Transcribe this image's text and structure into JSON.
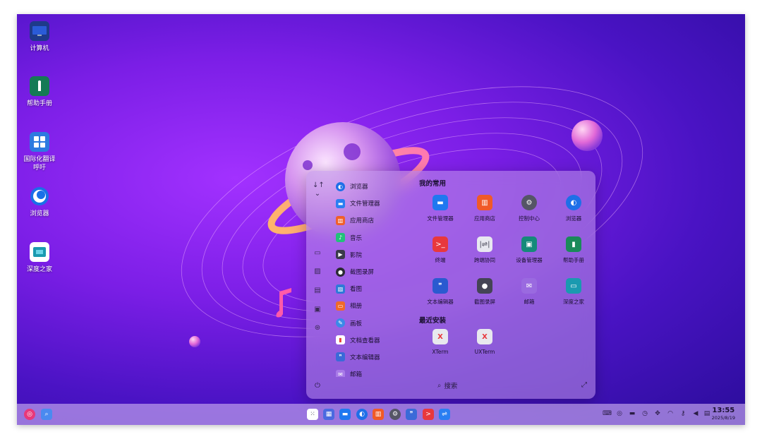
{
  "desktop": {
    "icons": [
      {
        "label": "计算机",
        "icon": "computer-icon"
      },
      {
        "label": "帮助手册",
        "icon": "help-manual-icon"
      },
      {
        "label": "国际化翻译",
        "label2": "呼吁",
        "icon": "translate-icon"
      },
      {
        "label": "浏览器",
        "icon": "browser-icon"
      },
      {
        "label": "深度之家",
        "icon": "deepin-home-icon"
      }
    ]
  },
  "launcher": {
    "applist": [
      {
        "label": "浏览器",
        "color": "#1e6fe8"
      },
      {
        "label": "文件管理器",
        "color": "#2a7ef2"
      },
      {
        "label": "应用商店",
        "color": "#f0602a"
      },
      {
        "label": "音乐",
        "color": "#22c27a"
      },
      {
        "label": "影院",
        "color": "#3a3a4a"
      },
      {
        "label": "截图录屏",
        "color": "#2a2a33"
      },
      {
        "label": "看图",
        "color": "#2e7ad8"
      },
      {
        "label": "相册",
        "color": "#f06a2a"
      },
      {
        "label": "画板",
        "color": "#3a8ae8"
      },
      {
        "label": "文档查看器",
        "color": "#e83a3a"
      },
      {
        "label": "文本编辑器",
        "color": "#3a6ad8"
      },
      {
        "label": "邮箱",
        "color": "#a87ae8"
      }
    ],
    "favorites_title": "我的常用",
    "favorites": [
      {
        "label": "文件管理器",
        "color": "#1f78f0"
      },
      {
        "label": "应用商店",
        "color": "#f05a28"
      },
      {
        "label": "控制中心",
        "color": "#555566"
      },
      {
        "label": "浏览器",
        "color": "#1e6fe8"
      },
      {
        "label": "终端",
        "color": "#e8383d"
      },
      {
        "label": "跨端协同",
        "color": "#e8e8f0"
      },
      {
        "label": "设备管理器",
        "color": "#158a7a"
      },
      {
        "label": "帮助手册",
        "color": "#1a8a5a"
      },
      {
        "label": "文本编辑器",
        "color": "#2a5ad0"
      },
      {
        "label": "截图录屏",
        "color": "#444455"
      },
      {
        "label": "邮箱",
        "color": "#9a6ae0"
      },
      {
        "label": "深度之家",
        "color": "#1a9ab0"
      }
    ],
    "recent_title": "最近安装",
    "recent": [
      {
        "label": "XTerm",
        "color": "#e8e8ee"
      },
      {
        "label": "UXTerm",
        "color": "#e8e8ee"
      }
    ],
    "search_label": "搜索"
  },
  "taskbar": {
    "clock_time": "13:55",
    "clock_date": "2025/8/19"
  }
}
